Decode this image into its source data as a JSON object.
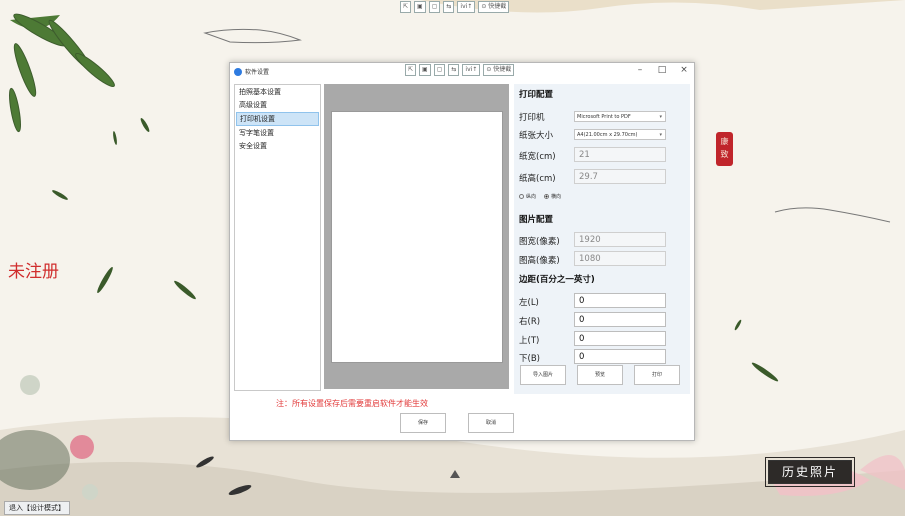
{
  "window": {
    "title": "软件设置",
    "minimize": "–",
    "maximize": "□",
    "close": "×"
  },
  "toolbar_items": [
    "⇱",
    "▣",
    "▢",
    "⇆",
    "ivi↑",
    "⊙ 快捷截"
  ],
  "left_nav": {
    "items": [
      "拍照基本设置",
      "高级设置",
      "打印机设置",
      "写字笔设置",
      "安全设置"
    ],
    "selected_index": 2
  },
  "print_config": {
    "section_title": "打印配置",
    "printer_label": "打印机",
    "printer_value": "Microsoft Print to PDF",
    "paper_size_label": "纸张大小",
    "paper_size_value": "A4(21.00cm x 29.70cm)",
    "paper_width_label": "纸宽(cm)",
    "paper_width_value": "21",
    "paper_height_label": "纸高(cm)",
    "paper_height_value": "29.7",
    "orientation_portrait": "纵向",
    "orientation_landscape": "横向",
    "orientation_selected": "横向"
  },
  "image_config": {
    "section_title": "图片配置",
    "width_label": "图宽(像素)",
    "width_value": "1920",
    "height_label": "图高(像素)",
    "height_value": "1080"
  },
  "margin_config": {
    "section_title": "边距(百分之一英寸)",
    "left_label": "左(L)",
    "left_value": "0",
    "right_label": "右(R)",
    "right_value": "0",
    "top_label": "上(T)",
    "top_value": "0",
    "bottom_label": "下(B)",
    "bottom_value": "0"
  },
  "panel_buttons": {
    "import": "导入图片",
    "preview": "预览",
    "print": "打印"
  },
  "footer": {
    "note": "注：所有设置保存后需要重启软件才能生效",
    "save": "保存",
    "cancel": "取消"
  },
  "background": {
    "unregistered": "未注册",
    "status_bar": "退入【设计模式】",
    "history_button": "历史照片",
    "seal_text": "康 致"
  },
  "colors": {
    "accent": "#2e7be0",
    "note_red": "#e23b3b",
    "unregistered_red": "#d02d2d",
    "selected_bg": "#cde4f7",
    "preview_gray": "#a9a9a9",
    "panel_bg": "#eef3f8"
  }
}
